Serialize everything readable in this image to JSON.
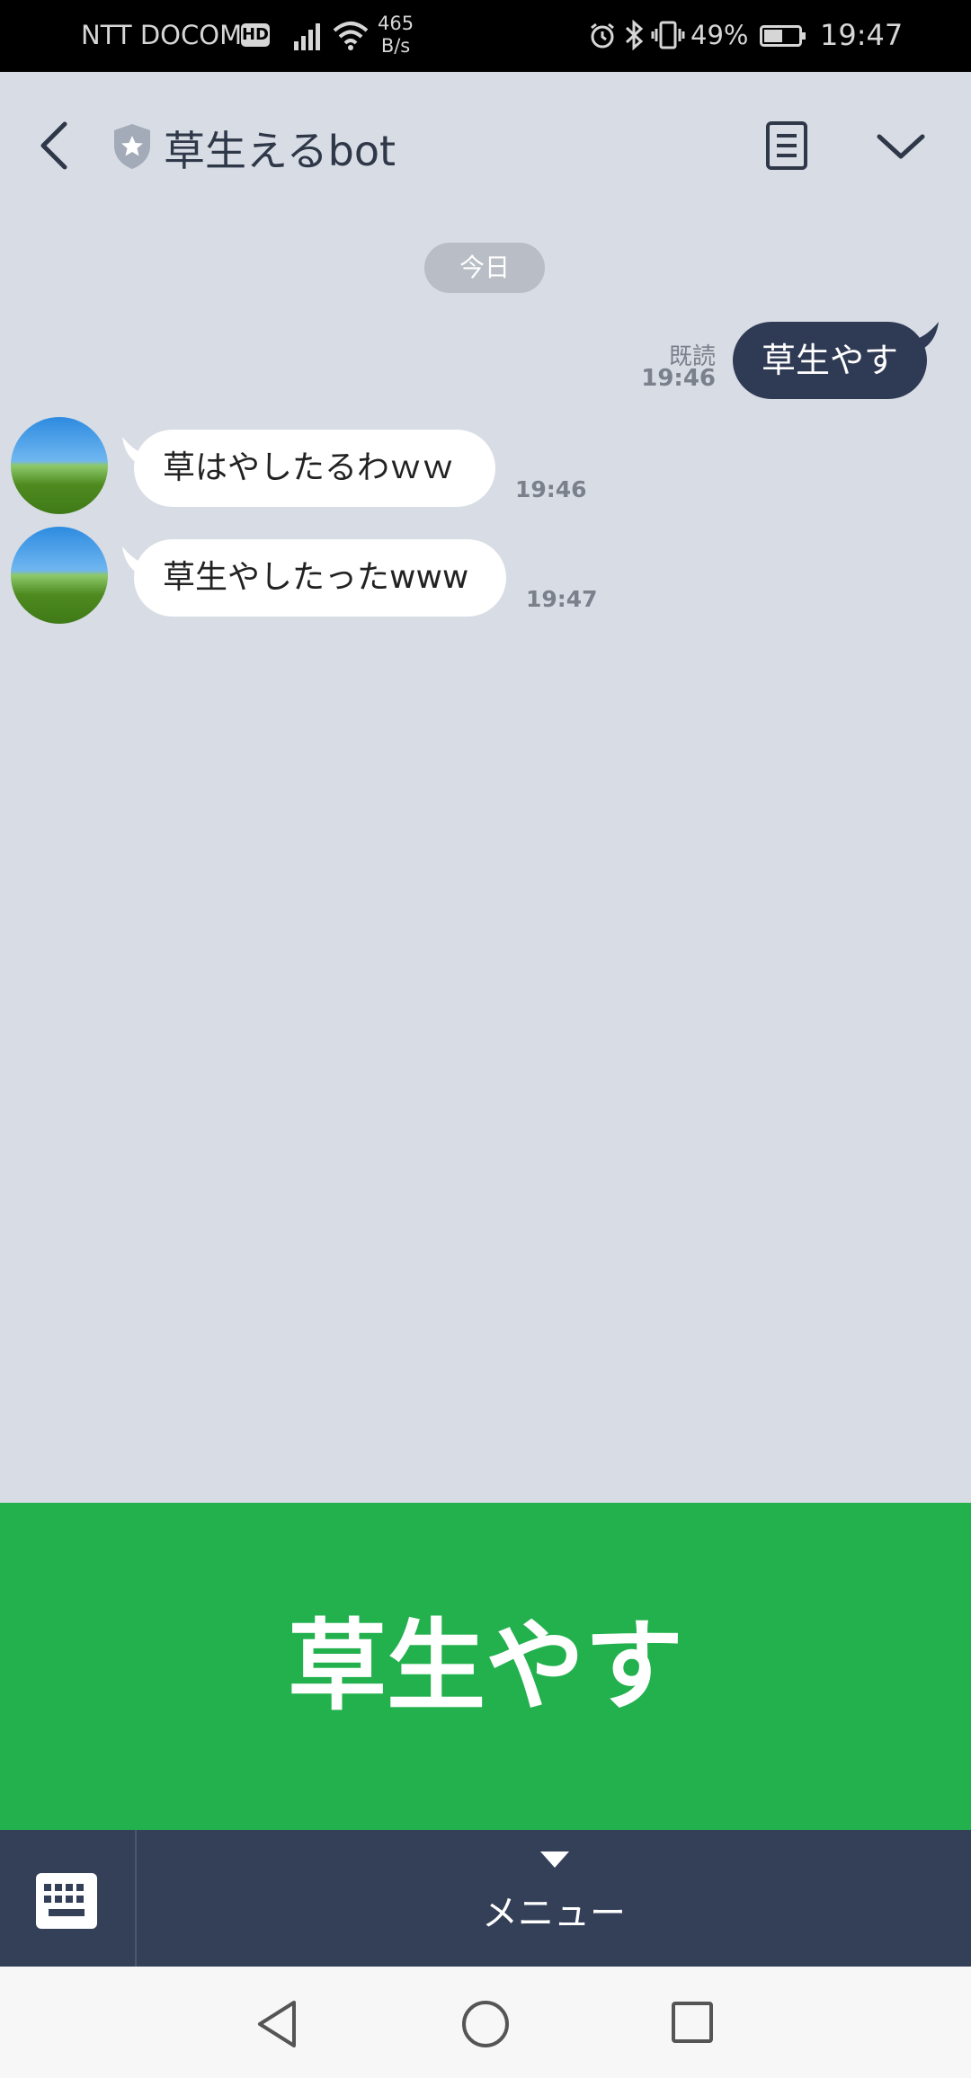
{
  "status_bar": {
    "carrier": "NTT DOCOMO",
    "hd_badge": "HD",
    "net_speed_value": "465",
    "net_speed_unit": "B/s",
    "battery_percent": "49%",
    "time": "19:47"
  },
  "header": {
    "title": "草生えるbot",
    "icons": [
      "back-chevron-icon",
      "official-shield-icon",
      "notes-icon",
      "chevron-down-icon"
    ]
  },
  "chat": {
    "date_label": "今日",
    "sent": {
      "read_label": "既読",
      "time": "19:46",
      "text": "草生やす"
    },
    "received": [
      {
        "text": "草はやしたるわｗｗ",
        "time": "19:46"
      },
      {
        "text": "草生やしたったwww",
        "time": "19:47"
      }
    ]
  },
  "rich_menu": {
    "label": "草生やす",
    "color": "#23b14d"
  },
  "bottom_bar": {
    "menu_label": "メニュー",
    "keyboard_icon": "keyboard-icon"
  },
  "colors": {
    "chat_background": "#d8dce4",
    "sent_bubble": "#2f3a54",
    "bottom_bar": "#334058"
  }
}
